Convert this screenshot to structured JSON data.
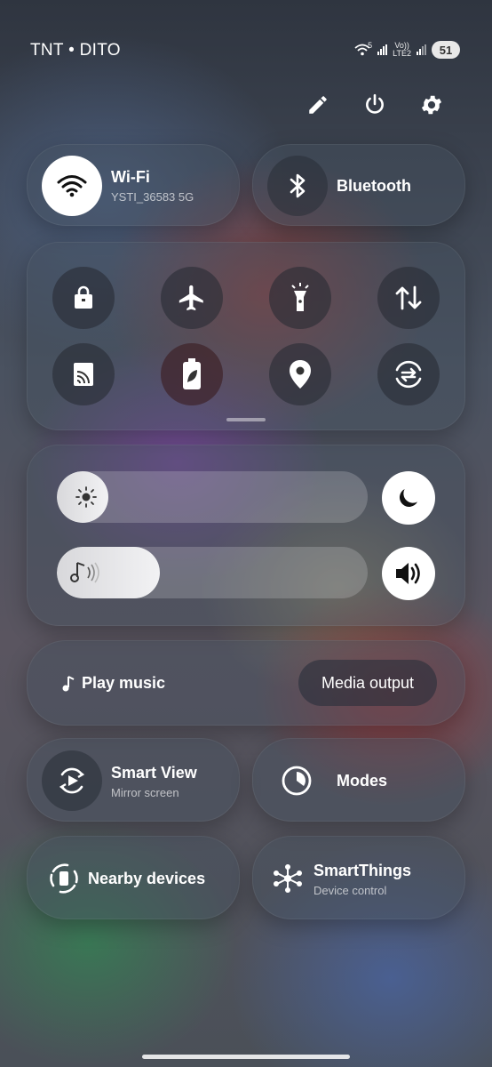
{
  "status": {
    "carrier": "TNT • DITO",
    "wifi_badge": "5",
    "volte_label": "Vo))",
    "lte_label": "LTE2",
    "battery": "51"
  },
  "top_actions": {
    "icons": [
      "pencil-icon",
      "power-icon",
      "gear-icon"
    ]
  },
  "wifi": {
    "title": "Wi-Fi",
    "subtitle": "YSTI_36583 5G",
    "active": true
  },
  "bluetooth": {
    "title": "Bluetooth",
    "active": false
  },
  "quick_toggles": [
    "lock-icon",
    "airplane-icon",
    "flashlight-icon",
    "data-transfer-icon",
    "cast-icon",
    "battery-saver-icon",
    "location-icon",
    "sync-icon"
  ],
  "sliders": {
    "brightness_level": 0.14,
    "volume_level": 0.33
  },
  "media": {
    "play_label": "Play music",
    "output_label": "Media output"
  },
  "tiles": {
    "smart_view": {
      "title": "Smart View",
      "subtitle": "Mirror screen"
    },
    "modes": {
      "title": "Modes"
    },
    "nearby": {
      "title": "Nearby devices"
    },
    "smartthings": {
      "title": "SmartThings",
      "subtitle": "Device control"
    }
  },
  "colors": {
    "active_toggle": "#ffffff",
    "inactive_toggle": "#282c34"
  }
}
